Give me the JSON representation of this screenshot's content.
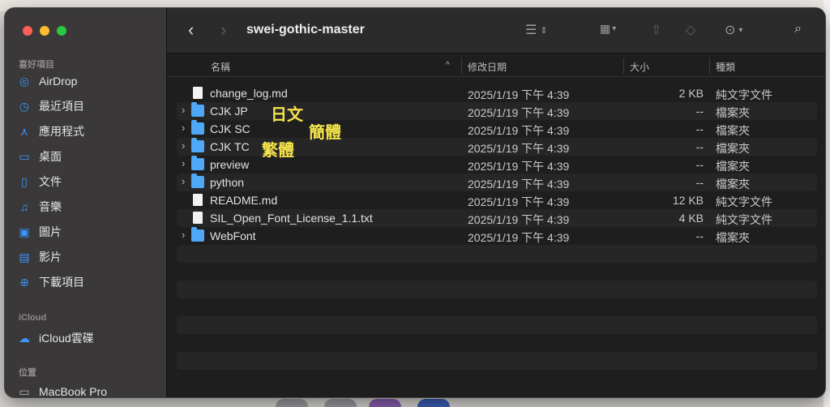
{
  "window": {
    "title": "swei-gothic-master"
  },
  "sidebar": {
    "favorites_heading": "喜好項目",
    "favorites": [
      {
        "label": "AirDrop",
        "icon": "airdrop-icon"
      },
      {
        "label": "最近項目",
        "icon": "clock-icon"
      },
      {
        "label": "應用程式",
        "icon": "applications-icon"
      },
      {
        "label": "桌面",
        "icon": "desktop-icon"
      },
      {
        "label": "文件",
        "icon": "document-icon"
      },
      {
        "label": "音樂",
        "icon": "music-icon"
      },
      {
        "label": "圖片",
        "icon": "photo-icon"
      },
      {
        "label": "影片",
        "icon": "film-icon"
      },
      {
        "label": "下載項目",
        "icon": "download-icon"
      }
    ],
    "icloud_heading": "iCloud",
    "icloud": [
      {
        "label": "iCloud雲碟",
        "icon": "cloud-icon"
      }
    ],
    "locations_heading": "位置",
    "locations": [
      {
        "label": "MacBook Pro",
        "icon": "laptop-icon"
      }
    ]
  },
  "toolbar": {
    "back_icon": "chevron-left-icon",
    "forward_icon": "chevron-right-icon",
    "view_icon": "list-view-icon",
    "group_icon": "group-icon",
    "share_icon": "share-icon",
    "tag_icon": "tag-icon",
    "more_icon": "ellipsis-circle-icon",
    "search_icon": "search-icon"
  },
  "columns": {
    "name": "名稱",
    "date": "修改日期",
    "size": "大小",
    "kind": "種類"
  },
  "files": [
    {
      "name": "change_log.md",
      "type": "file",
      "date": "2025/1/19 下午 4:39",
      "size": "2 KB",
      "kind": "純文字文件"
    },
    {
      "name": "CJK JP",
      "type": "folder",
      "date": "2025/1/19 下午 4:39",
      "size": "--",
      "kind": "檔案夾"
    },
    {
      "name": "CJK SC",
      "type": "folder",
      "date": "2025/1/19 下午 4:39",
      "size": "--",
      "kind": "檔案夾"
    },
    {
      "name": "CJK TC",
      "type": "folder",
      "date": "2025/1/19 下午 4:39",
      "size": "--",
      "kind": "檔案夾"
    },
    {
      "name": "preview",
      "type": "folder",
      "date": "2025/1/19 下午 4:39",
      "size": "--",
      "kind": "檔案夾"
    },
    {
      "name": "python",
      "type": "folder",
      "date": "2025/1/19 下午 4:39",
      "size": "--",
      "kind": "檔案夾"
    },
    {
      "name": "README.md",
      "type": "file",
      "date": "2025/1/19 下午 4:39",
      "size": "12 KB",
      "kind": "純文字文件"
    },
    {
      "name": "SIL_Open_Font_License_1.1.txt",
      "type": "file",
      "date": "2025/1/19 下午 4:39",
      "size": "4 KB",
      "kind": "純文字文件"
    },
    {
      "name": "WebFont",
      "type": "folder",
      "date": "2025/1/19 下午 4:39",
      "size": "--",
      "kind": "檔案夾"
    }
  ],
  "annotations": {
    "jp": "日文",
    "sc": "簡體",
    "tc": "繁體"
  },
  "colors": {
    "folder": "#4ea8f5",
    "annotation": "#f5e44a",
    "accent": "#3b97ff"
  }
}
